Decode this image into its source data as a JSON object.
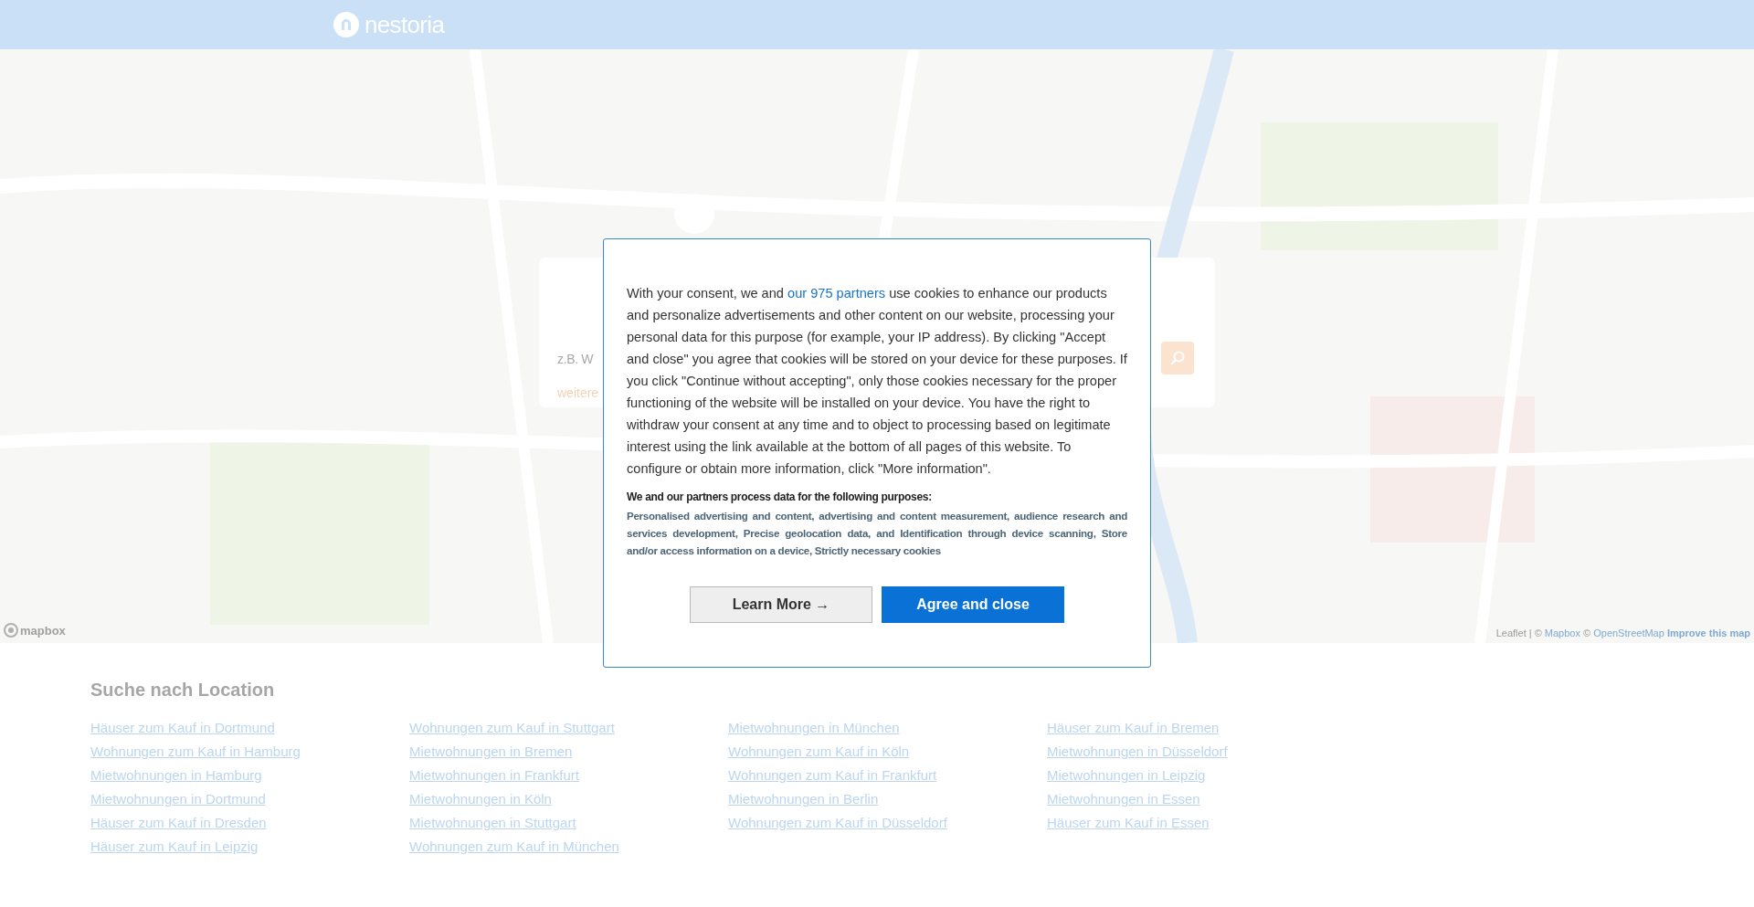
{
  "header": {
    "logo_text": "nestoria"
  },
  "map": {
    "logo_text": "mapbox",
    "attribution": [
      {
        "text": "Leaflet | © ",
        "kind": "plain"
      },
      {
        "text": "Mapbox",
        "kind": "link"
      },
      {
        "text": " © ",
        "kind": "plain"
      },
      {
        "text": "OpenStreetMap",
        "kind": "link"
      },
      {
        "text": " Improve this map",
        "kind": "strong"
      }
    ]
  },
  "search_card": {
    "placeholder": "z.B. W",
    "link": "weitere"
  },
  "consent": {
    "text_before": "With your consent, we and ",
    "link": "our 975 partners",
    "text_after": " use cookies to enhance our products and personalize advertisements and other content on our website, processing your personal data for this purpose (for example, your IP address). By clicking \"Accept and close\" you agree that cookies will be stored on your device for these purposes. If you click \"Continue without accepting\", only those cookies necessary for the proper functioning of the website will be installed on your device. You have the right to withdraw your consent at any time and to object to processing based on legitimate interest using the link available at the bottom of all pages of this website. To configure or obtain more information, click \"More information\".",
    "purposes_heading": "We and our partners process data for the following purposes:",
    "purposes": "Personalised advertising and content, advertising and content measurement, audience research and services development, Precise geolocation data, and Identification through device scanning, Store and/or access information on a device, Strictly necessary cookies",
    "buttons": [
      {
        "label": "Learn More →",
        "kind": "secondary"
      },
      {
        "label": "Agree and close",
        "kind": "primary"
      }
    ]
  },
  "locations": {
    "title": "Suche nach Location",
    "columns": [
      [
        "Häuser zum Kauf in Dortmund",
        "Wohnungen zum Kauf in Hamburg",
        "Mietwohnungen in Hamburg",
        "Mietwohnungen in Dortmund",
        "Häuser zum Kauf in Dresden",
        "Häuser zum Kauf in Leipzig"
      ],
      [
        "Wohnungen zum Kauf in Stuttgart",
        "Mietwohnungen in Bremen",
        "Mietwohnungen in Frankfurt",
        "Mietwohnungen in Köln",
        "Mietwohnungen in Stuttgart",
        "Wohnungen zum Kauf in München"
      ],
      [
        "Mietwohnungen in München",
        "Wohnungen zum Kauf in Köln",
        "Wohnungen zum Kauf in Frankfurt",
        "Mietwohnungen in Berlin",
        "Wohnungen zum Kauf in Düsseldorf"
      ],
      [
        "Häuser zum Kauf in Bremen",
        "Mietwohnungen in Düsseldorf",
        "Mietwohnungen in Leipzig",
        "Mietwohnungen in Essen",
        "Häuser zum Kauf in Essen"
      ]
    ]
  }
}
